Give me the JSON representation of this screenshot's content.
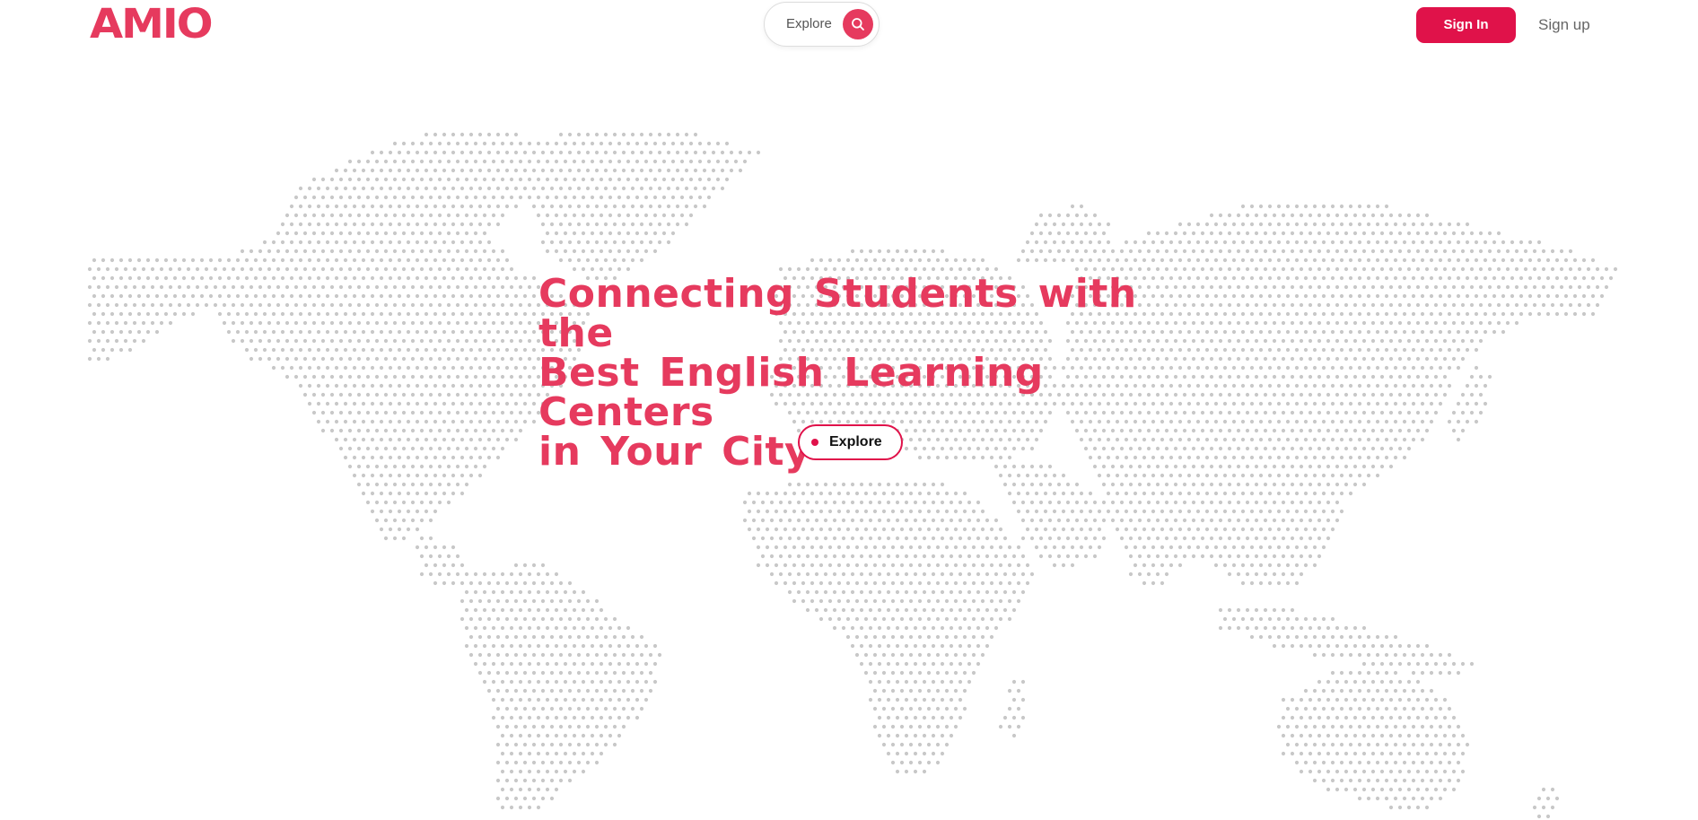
{
  "header": {
    "logo_text": "AMIO",
    "search": {
      "label": "Explore",
      "icon": "search-icon"
    },
    "sign_in_label": "Sign In",
    "sign_up_label": "Sign up"
  },
  "hero": {
    "title_lines": [
      "Connecting Students with the",
      "Best English Learning Centers",
      "in Your City"
    ],
    "explore_label": "Explore"
  },
  "colors": {
    "brand": "#e63a5e",
    "button": "#e0124a",
    "map_dots": "#c8c8c8"
  }
}
